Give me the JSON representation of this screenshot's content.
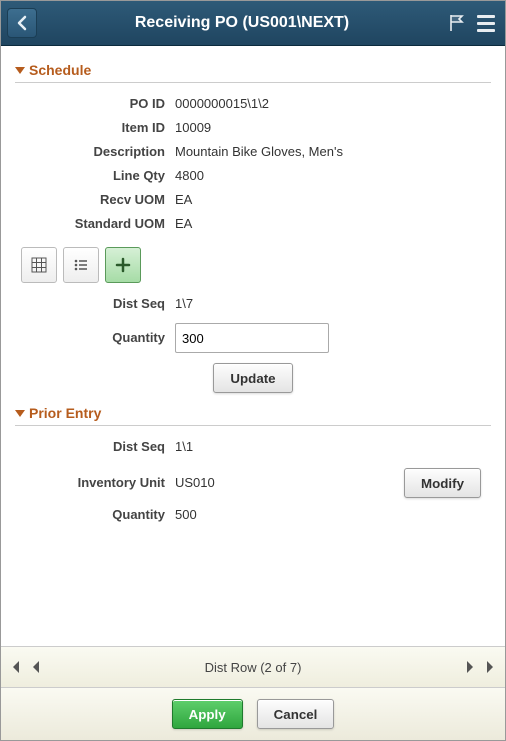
{
  "header": {
    "title": "Receiving PO (US001\\NEXT)"
  },
  "schedule": {
    "section_label": "Schedule",
    "labels": {
      "po_id": "PO ID",
      "item_id": "Item ID",
      "description": "Description",
      "line_qty": "Line Qty",
      "recv_uom": "Recv UOM",
      "standard_uom": "Standard UOM",
      "dist_seq": "Dist Seq",
      "quantity": "Quantity"
    },
    "po_id": "0000000015\\1\\2",
    "item_id": "10009",
    "description": "Mountain Bike Gloves, Men's",
    "line_qty": "4800",
    "recv_uom": "EA",
    "standard_uom": "EA",
    "dist_seq": "1\\7",
    "quantity_value": "300",
    "update_label": "Update"
  },
  "prior_entry": {
    "section_label": "Prior Entry",
    "labels": {
      "dist_seq": "Dist Seq",
      "inventory_unit": "Inventory Unit",
      "quantity": "Quantity"
    },
    "dist_seq": "1\\1",
    "inventory_unit": "US010",
    "quantity": "500",
    "modify_label": "Modify"
  },
  "pager": {
    "label": "Dist Row  (2 of 7)"
  },
  "footer": {
    "apply_label": "Apply",
    "cancel_label": "Cancel"
  }
}
